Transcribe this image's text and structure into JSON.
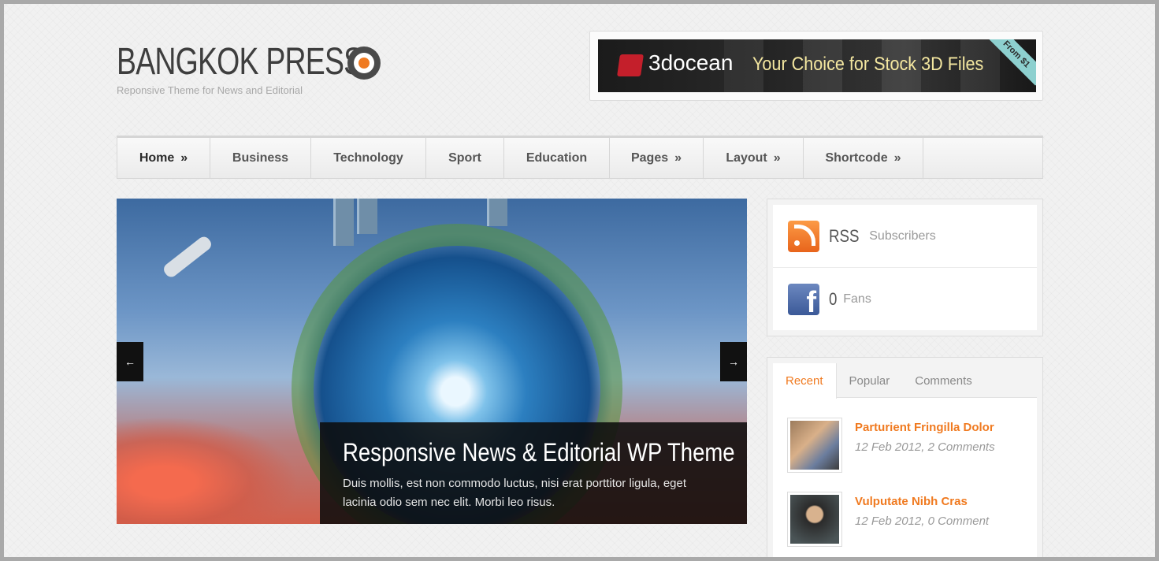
{
  "logo": {
    "title": "BANGKOK PRESS",
    "tagline": "Reponsive Theme for News and Editorial"
  },
  "ad": {
    "brand": "3docean",
    "slogan": "Your Choice for Stock 3D Files",
    "corner": "From $1"
  },
  "nav": [
    {
      "label": "Home",
      "arrow": "»"
    },
    {
      "label": "Business",
      "arrow": ""
    },
    {
      "label": "Technology",
      "arrow": ""
    },
    {
      "label": "Sport",
      "arrow": ""
    },
    {
      "label": "Education",
      "arrow": ""
    },
    {
      "label": "Pages",
      "arrow": "»"
    },
    {
      "label": "Layout",
      "arrow": "»"
    },
    {
      "label": "Shortcode",
      "arrow": "»"
    }
  ],
  "slider": {
    "prev": "←",
    "next": "→",
    "title": "Responsive News & Editorial WP Theme",
    "text": "Duis mollis, est non commodo luctus, nisi erat porttitor ligula, eget lacinia odio sem nec elit. Morbi leo risus."
  },
  "social": {
    "rss": {
      "count": "RSS",
      "label": "Subscribers",
      "icon": "rss-icon"
    },
    "facebook": {
      "count": "0",
      "label": "Fans",
      "icon": "facebook-icon",
      "glyph": "f"
    }
  },
  "tabs": [
    "Recent",
    "Popular",
    "Comments"
  ],
  "posts": [
    {
      "title": "Parturient Fringilla Dolor",
      "meta": "12 Feb 2012, 2 Comments"
    },
    {
      "title": "Vulputate Nibh Cras",
      "meta": "12 Feb 2012, 0 Comment"
    }
  ],
  "colors": {
    "accent": "#f07a20",
    "rss": "#f07a20",
    "facebook": "#3b5998"
  }
}
